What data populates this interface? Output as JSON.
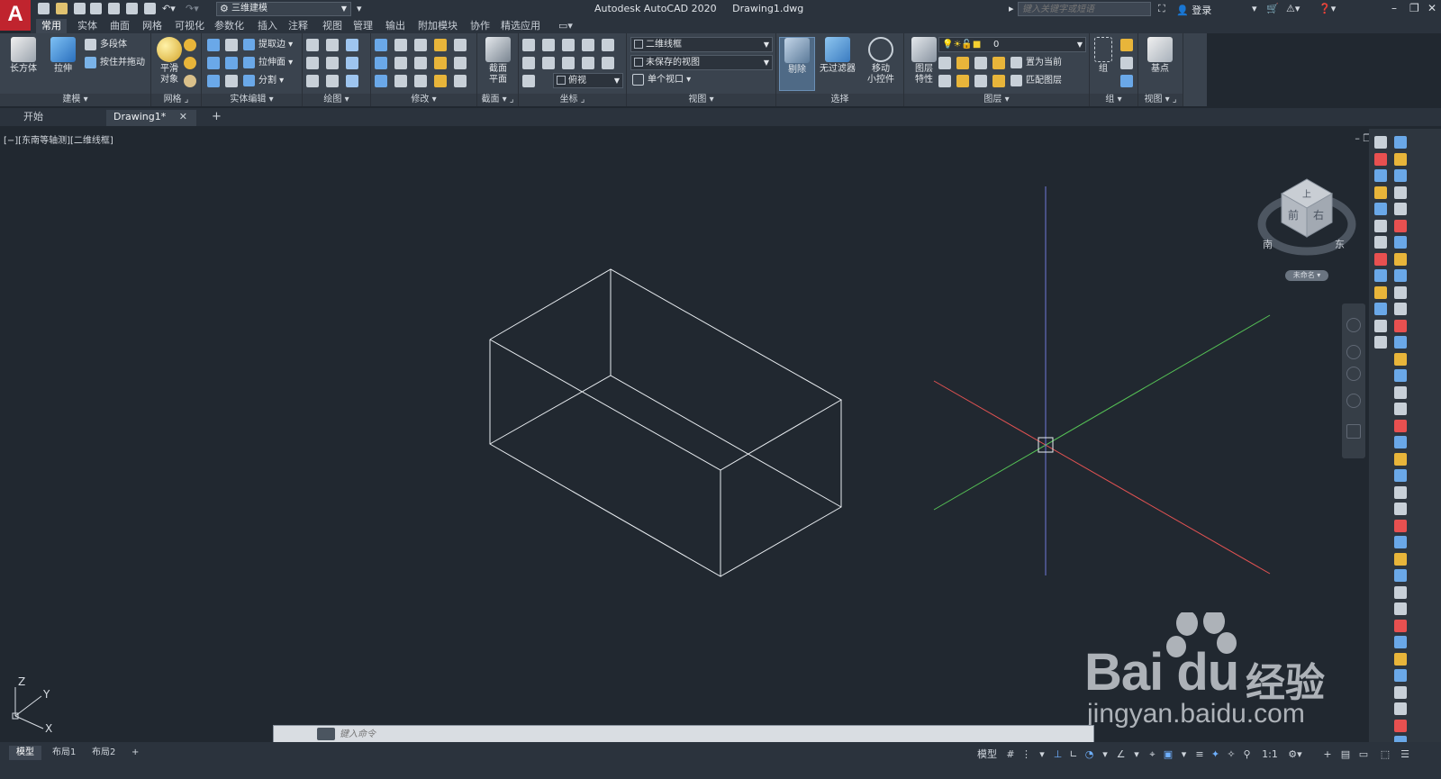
{
  "title_bar": {
    "app_logo": "A",
    "workspace": "三维建模",
    "app_name": "Autodesk AutoCAD 2020",
    "file_name": "Drawing1.dwg",
    "search_placeholder": "键入关键字或短语",
    "login_label": "登录"
  },
  "ribbon_tabs": [
    "常用",
    "实体",
    "曲面",
    "网格",
    "可视化",
    "参数化",
    "插入",
    "注释",
    "视图",
    "管理",
    "输出",
    "附加模块",
    "协作",
    "精选应用"
  ],
  "active_ribbon_tab": "常用",
  "panels": {
    "modeling": {
      "title": "建模",
      "box": "长方体",
      "extrude": "拉伸",
      "polysolid": "多段体",
      "presspull": "按住并拖动"
    },
    "mesh": {
      "title": "网格",
      "smooth": "平滑\n对象"
    },
    "solid_edit": {
      "title": "实体编辑",
      "extract": "提取边",
      "extrude_face": "拉伸面",
      "separate": "分割"
    },
    "draw": {
      "title": "绘图"
    },
    "modify": {
      "title": "修改"
    },
    "section": {
      "title": "截面",
      "plane": "截面\n平面"
    },
    "coordinates": {
      "title": "坐标",
      "view_combo": "俯视"
    },
    "view": {
      "title": "视图",
      "visual_style": "二维线框",
      "saved_view": "未保存的视图",
      "viewport": "单个视口"
    },
    "selection": {
      "title": "选择",
      "cull": "剔除",
      "no_filter": "无过滤器",
      "gizmo": "移动\n小控件"
    },
    "layers": {
      "title": "图层",
      "layer_props": "图层\n特性",
      "layer_combo": "0",
      "set_current": "置为当前",
      "match_layer": "匹配图层"
    },
    "groups": {
      "title": "组",
      "group": "组"
    },
    "view2": {
      "title": "视图",
      "base": "基点"
    }
  },
  "doc_tabs": [
    {
      "label": "开始"
    },
    {
      "label": "Drawing1*"
    }
  ],
  "viewport": {
    "label": "[−][东南等轴测][二维线框]",
    "viewcube_faces": {
      "top": "上",
      "front": "前",
      "right": "右"
    },
    "viewcube_compass": {
      "south": "南",
      "east": "东"
    },
    "ucs_name": "未命名",
    "ucs_axes": {
      "x": "X",
      "y": "Y",
      "z": "Z"
    }
  },
  "command_line": {
    "placeholder": "键入命令"
  },
  "layout_tabs": [
    "模型",
    "布局1",
    "布局2"
  ],
  "status_bar": {
    "model": "模型",
    "scale": "1:1"
  },
  "watermark": {
    "brand": "Bai du",
    "cn": "经验",
    "url": "jingyan.baidu.com"
  },
  "colors": {
    "accent": "#3d8ee6",
    "logo_red": "#c0242e",
    "axis_x": "#e05252",
    "axis_y": "#55c155",
    "axis_z": "#6f79d9",
    "background": "#212830"
  }
}
